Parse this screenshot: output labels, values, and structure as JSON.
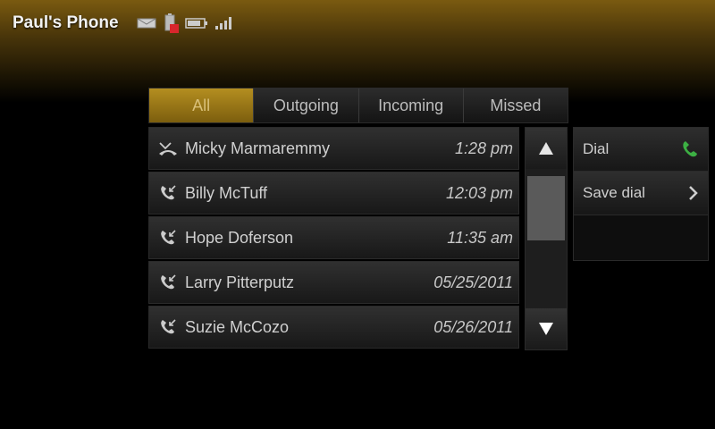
{
  "status_bar": {
    "phone_name": "Paul's Phone",
    "icons": [
      "message-icon",
      "battery-alert-icon",
      "battery-icon",
      "signal-icon"
    ]
  },
  "tabs": [
    {
      "label": "All",
      "active": true
    },
    {
      "label": "Outgoing",
      "active": false
    },
    {
      "label": "Incoming",
      "active": false
    },
    {
      "label": "Missed",
      "active": false
    }
  ],
  "calls": [
    {
      "name": "Micky Marmaremmy",
      "time": "1:28 pm",
      "icon": "missed-call-icon"
    },
    {
      "name": "Billy McTuff",
      "time": "12:03 pm",
      "icon": "incoming-call-icon"
    },
    {
      "name": "Hope Doferson",
      "time": "11:35 am",
      "icon": "incoming-call-icon"
    },
    {
      "name": "Larry Pitterputz",
      "time": "05/25/2011",
      "icon": "incoming-call-icon"
    },
    {
      "name": "Suzie McCozo",
      "time": "05/26/2011",
      "icon": "incoming-call-icon"
    }
  ],
  "actions": {
    "dial_label": "Dial",
    "save_dial_label": "Save dial"
  },
  "colors": {
    "accent": "#9a7716",
    "call_green": "#3cb043"
  }
}
